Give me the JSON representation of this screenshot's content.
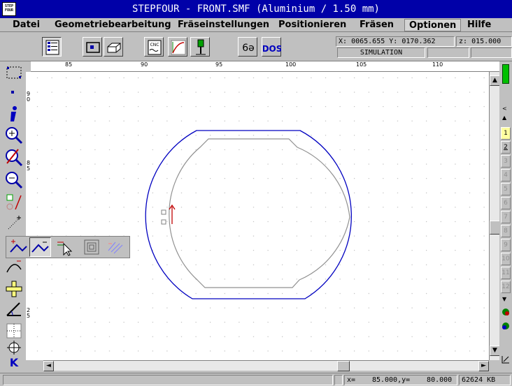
{
  "window": {
    "title": "STEPFOUR - FRONT.SMF (Aluminium / 1.50 mm)",
    "app_icon_line1": "STEP",
    "app_icon_line2": "FOUR"
  },
  "menu": [
    {
      "label": "Datei"
    },
    {
      "label": "Geometriebearbeitung"
    },
    {
      "label": "Fräseinstellungen"
    },
    {
      "label": "Positionieren"
    },
    {
      "label": "Fräsen"
    },
    {
      "label": "Optionen",
      "active": true
    },
    {
      "label": "Hilfe"
    }
  ],
  "toolbar": {
    "coords": {
      "x_label": "X:",
      "x_value": "0065.655",
      "y_label": "Y:",
      "y_value": "0170.362",
      "z_label": "z:",
      "z_value": "015.000"
    },
    "mode": "SIMULATION",
    "cnc_label": "CNC",
    "dos_label": "DOS",
    "glasses_label": "6ə"
  },
  "ruler": {
    "h_labels": [
      "85",
      "90",
      "95",
      "100",
      "105",
      "110"
    ],
    "v_labels": [
      "90",
      "85",
      "25"
    ]
  },
  "right_strip": {
    "numbers": [
      "1",
      "2",
      "3",
      "4",
      "5",
      "6",
      "7",
      "8",
      "9",
      "10",
      "11",
      "12"
    ]
  },
  "left_tools": {
    "k_label": "K"
  },
  "status": {
    "x_label": "x=",
    "x_value": "85.000",
    "y_label": ",y=",
    "y_value": "80.000",
    "memory": "62624 KB"
  },
  "colors": {
    "title_bar": "#0000a8",
    "contour": "#0000c0",
    "toolpath": "#909090",
    "marker": "#c00000"
  }
}
